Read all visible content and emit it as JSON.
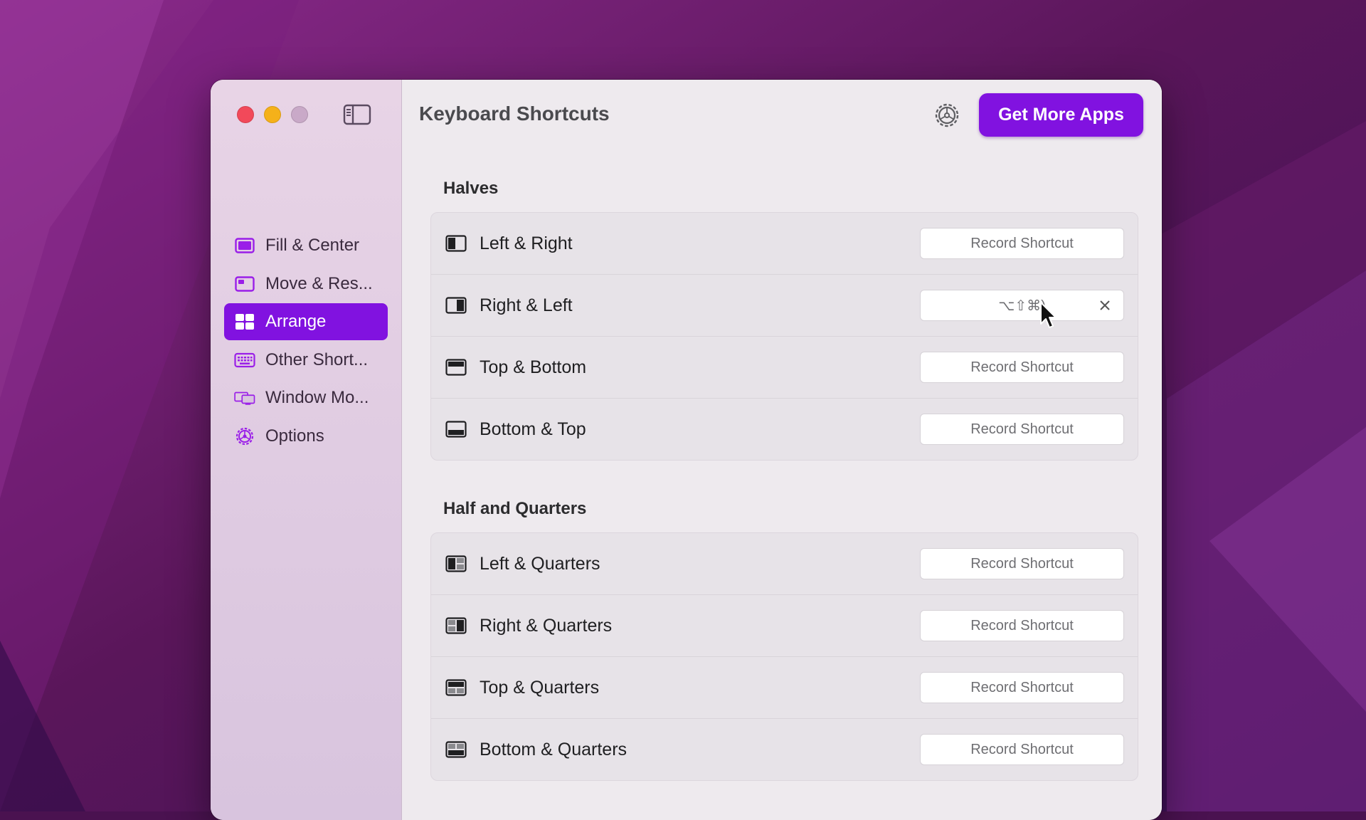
{
  "colors": {
    "accent": "#8112e0",
    "close": "#f2495a",
    "minimize": "#f5b11a",
    "zoom": "#c9a9c8"
  },
  "window": {
    "title": "Keyboard Shortcuts",
    "get_more_label": "Get More Apps"
  },
  "sidebar": {
    "items": [
      {
        "label": "Fill & Center",
        "icon": "fill-center-icon",
        "active": false
      },
      {
        "label": "Move & Res...",
        "icon": "move-resize-icon",
        "active": false
      },
      {
        "label": "Arrange",
        "icon": "arrange-grid-icon",
        "active": true
      },
      {
        "label": "Other Short...",
        "icon": "keyboard-icon",
        "active": false
      },
      {
        "label": "Window Mo...",
        "icon": "monitors-icon",
        "active": false
      },
      {
        "label": "Options",
        "icon": "gear-icon",
        "active": false
      }
    ]
  },
  "sections": [
    {
      "title": "Halves",
      "rows": [
        {
          "label": "Left & Right",
          "icon": "left-half-icon",
          "shortcut": "Record Shortcut"
        },
        {
          "label": "Right & Left",
          "icon": "right-half-icon",
          "shortcut": "⌥⇧⌘)"
        },
        {
          "label": "Top & Bottom",
          "icon": "top-half-icon",
          "shortcut": "Record Shortcut"
        },
        {
          "label": "Bottom & Top",
          "icon": "bottom-half-icon",
          "shortcut": "Record Shortcut"
        }
      ]
    },
    {
      "title": "Half and Quarters",
      "rows": [
        {
          "label": "Left & Quarters",
          "icon": "left-quarters-icon",
          "shortcut": "Record Shortcut"
        },
        {
          "label": "Right & Quarters",
          "icon": "right-quarters-icon",
          "shortcut": "Record Shortcut"
        },
        {
          "label": "Top & Quarters",
          "icon": "top-quarters-icon",
          "shortcut": "Record Shortcut"
        },
        {
          "label": "Bottom & Quarters",
          "icon": "bottom-quarters-icon",
          "shortcut": "Record Shortcut"
        }
      ]
    }
  ]
}
